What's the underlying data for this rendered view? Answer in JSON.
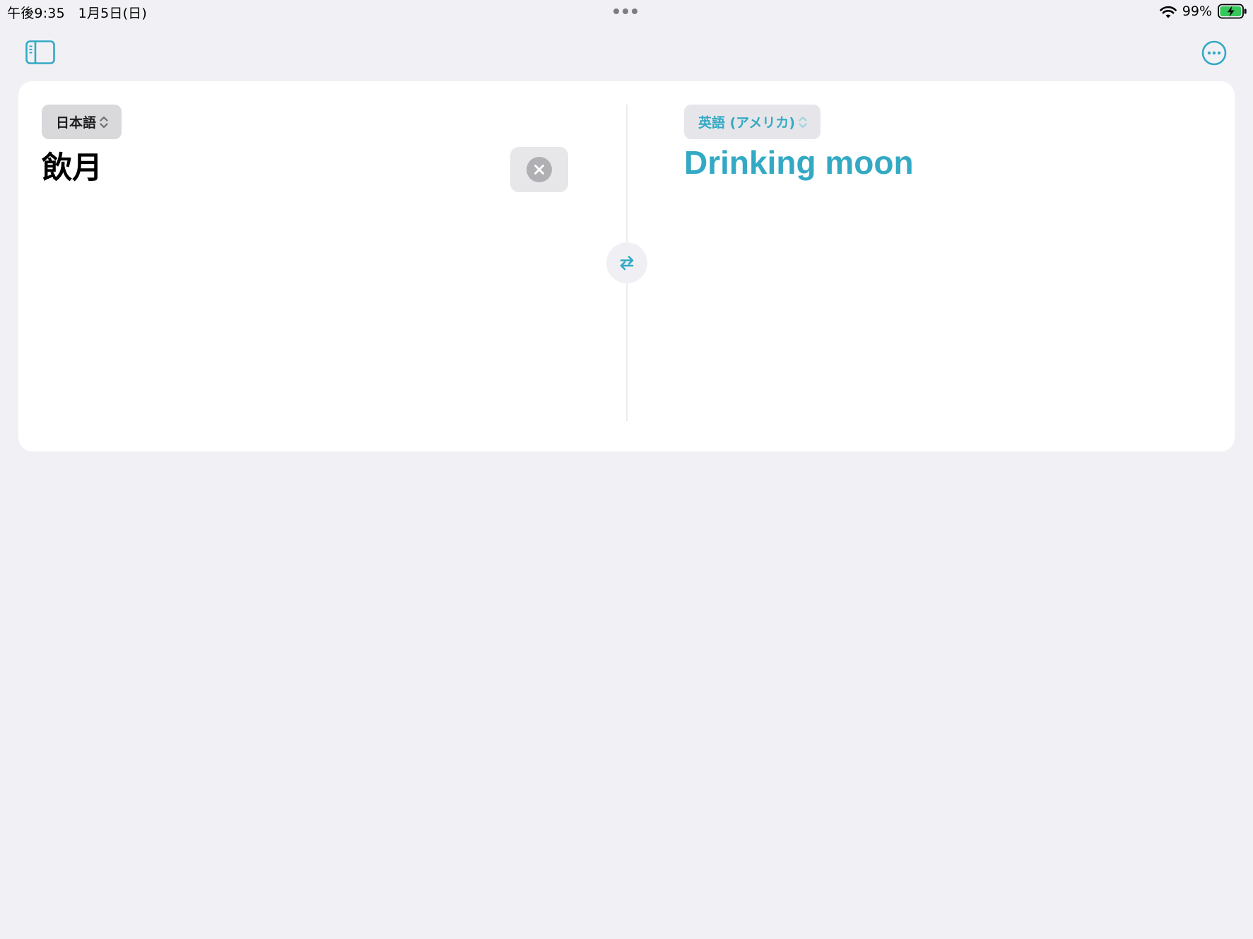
{
  "status_bar": {
    "time": "午後9:35",
    "date": "1月5日(日)",
    "battery_percent": "99%",
    "battery_level": 0.99,
    "charging": true
  },
  "toolbar": {
    "sidebar_icon": "sidebar-toggle-icon",
    "more_icon": "ellipsis-circle-icon"
  },
  "source": {
    "language": "日本語",
    "text": "飲月"
  },
  "target": {
    "language": "英語 (アメリカ)",
    "text": "Drinking moon"
  },
  "colors": {
    "accent": "#33a9c4",
    "background": "#f1f1f5",
    "card": "#ffffff"
  }
}
